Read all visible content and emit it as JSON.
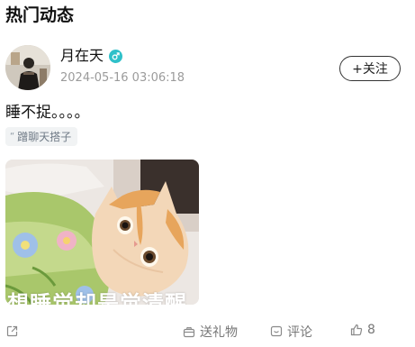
{
  "section": {
    "title": "热门动态"
  },
  "post": {
    "author": {
      "name": "月在天",
      "gender_icon": "male-icon",
      "gender_color": "#2fc0c9"
    },
    "time": "2024-05-16 03:06:18",
    "follow_label": "+关注",
    "text": "睡不捉。。。。",
    "topic": "蹭聊天搭子",
    "image": {
      "caption": "想睡觉却是觉清醒",
      "subject": "orange-white-kitten-under-blanket"
    },
    "actions": {
      "gift_label": "送礼物",
      "comment_label": "评论",
      "like_count": "8"
    }
  }
}
